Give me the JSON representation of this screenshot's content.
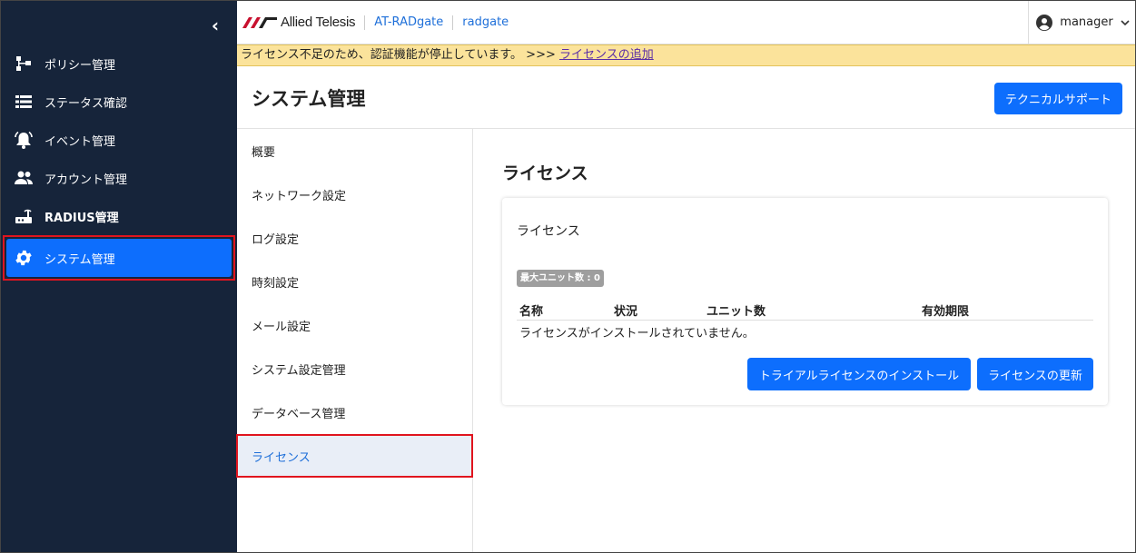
{
  "sidebar": {
    "collapse": "‹",
    "items": [
      {
        "label": "ポリシー管理",
        "icon": "policy-tree-icon"
      },
      {
        "label": "ステータス確認",
        "icon": "list-icon"
      },
      {
        "label": "イベント管理",
        "icon": "alarm-bell-icon"
      },
      {
        "label": "アカウント管理",
        "icon": "users-icon"
      },
      {
        "label": "RADIUS管理",
        "icon": "router-icon"
      },
      {
        "label": "システム管理",
        "icon": "gear-icon"
      }
    ]
  },
  "topbar": {
    "brand": "Allied Telesis",
    "product": "AT-RADgate",
    "host": "radgate",
    "user": "manager"
  },
  "alert": {
    "message": "ライセンス不足のため、認証機能が停止しています。 >>> ",
    "link": "ライセンスの追加"
  },
  "page": {
    "title": "システム管理",
    "support_button": "テクニカルサポート"
  },
  "subnav": {
    "items": [
      "概要",
      "ネットワーク設定",
      "ログ設定",
      "時刻設定",
      "メール設定",
      "システム設定管理",
      "データベース管理",
      "ライセンス"
    ]
  },
  "license": {
    "section_title": "ライセンス",
    "card_title": "ライセンス",
    "badge": "最大ユニット数 : 0",
    "columns": [
      "名称",
      "状況",
      "ユニット数",
      "有効期限"
    ],
    "empty_message": "ライセンスがインストールされていません。",
    "install_button": "トライアルライセンスのインストール",
    "update_button": "ライセンスの更新"
  },
  "colors": {
    "sidebar_bg": "#16243a",
    "accent": "#0d6efd",
    "alert_bg": "#fbe39b",
    "highlight_border": "#e0141e"
  }
}
